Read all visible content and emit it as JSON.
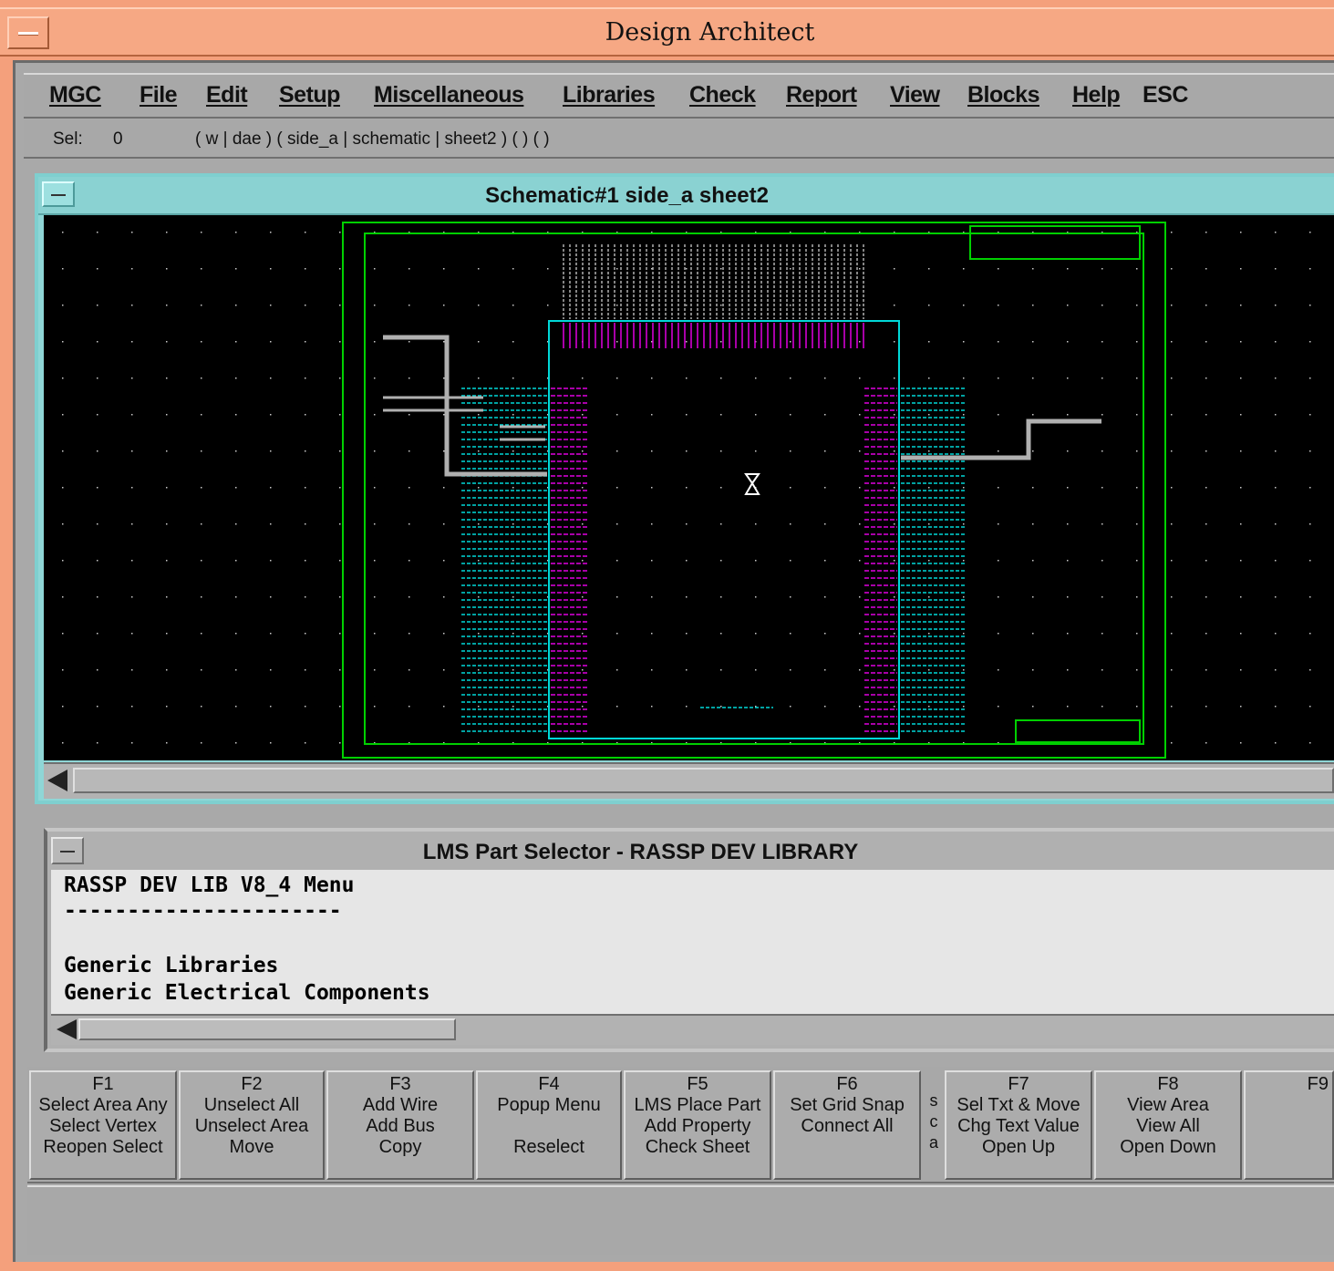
{
  "window": {
    "title": "Design Architect"
  },
  "menubar": {
    "items": [
      "MGC",
      "File",
      "Edit",
      "Setup",
      "Miscellaneous",
      "Libraries",
      "Check",
      "Report",
      "View",
      "Blocks",
      "Help",
      "ESC"
    ]
  },
  "status": {
    "sel_label": "Sel:",
    "sel_count": "0",
    "context": "( w | dae ) ( side_a | schematic | sheet2 ) (  ) (  )"
  },
  "schematic": {
    "title": "Schematic#1 side_a sheet2"
  },
  "part_selector": {
    "title": "LMS Part Selector - RASSP DEV LIBRARY",
    "lines": [
      "RASSP DEV LIB V8_4 Menu",
      "----------------------",
      "",
      "Generic Libraries",
      "Generic Electrical Components"
    ]
  },
  "fkeys": [
    {
      "key": "F1",
      "lines": [
        "Select Area Any",
        "Select Vertex",
        "Reopen Select"
      ]
    },
    {
      "key": "F2",
      "lines": [
        "Unselect All",
        "Unselect Area",
        "Move"
      ]
    },
    {
      "key": "F3",
      "lines": [
        "Add Wire",
        "Add Bus",
        "Copy"
      ]
    },
    {
      "key": "F4",
      "lines": [
        "Popup Menu",
        "",
        "Reselect"
      ]
    },
    {
      "key": "F5",
      "lines": [
        "LMS Place Part",
        "Add Property",
        "Check Sheet"
      ]
    },
    {
      "key": "F6",
      "lines": [
        "Set Grid Snap",
        "Connect All",
        ""
      ]
    },
    {
      "key": "F7",
      "lines": [
        "Sel Txt & Move",
        "Chg Text Value",
        "Open Up"
      ]
    },
    {
      "key": "F8",
      "lines": [
        "View Area",
        "View All",
        "Open Down"
      ]
    },
    {
      "key": "F9",
      "lines": [
        "",
        "",
        ""
      ]
    }
  ],
  "fkey_side_label": [
    "s",
    "c",
    "a"
  ],
  "colors": {
    "titlebar": "#f6a884",
    "schematic_title": "#8ad2d2",
    "sheet_border": "#00d000",
    "component": "#00d8d8",
    "pins": "#e000e0",
    "wires": "#b0b0b0"
  }
}
